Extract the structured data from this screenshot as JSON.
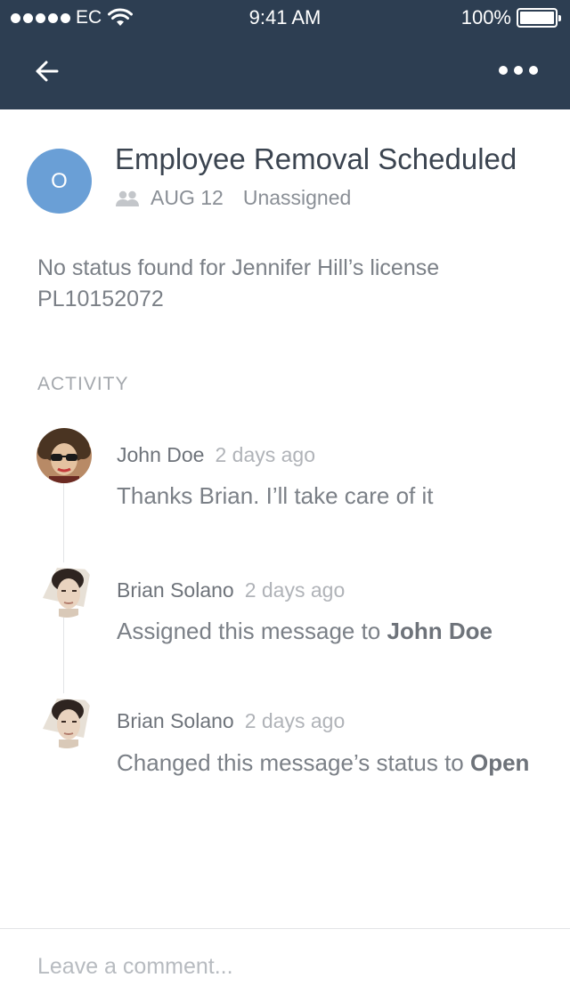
{
  "status_bar": {
    "carrier": "EC",
    "time": "9:41 AM",
    "battery": "100%"
  },
  "nav": {
    "back_icon": "arrow-left-icon",
    "more_icon": "more-horizontal-icon"
  },
  "message": {
    "avatar_initial": "O",
    "avatar_color": "#6a9fd6",
    "title": "Employee Removal Scheduled",
    "date": "AUG 12",
    "assignee": "Unassigned",
    "description": "No status found for Jennifer Hill’s license PL10152072"
  },
  "activity": {
    "heading": "ACTIVITY",
    "items": [
      {
        "author": "John Doe",
        "time": "2 days ago",
        "text": "Thanks Brian. I’ll take care of it"
      },
      {
        "author": "Brian Solano",
        "time": "2 days ago",
        "text_prefix": "Assigned this message to ",
        "text_strong": "John Doe"
      },
      {
        "author": "Brian Solano",
        "time": "2 days ago",
        "text_prefix": "Changed this message’s status to ",
        "text_strong": "Open"
      }
    ]
  },
  "comment": {
    "placeholder": "Leave a comment..."
  },
  "colors": {
    "header_bg": "#2d3e52",
    "accent": "#6a9fd6"
  }
}
